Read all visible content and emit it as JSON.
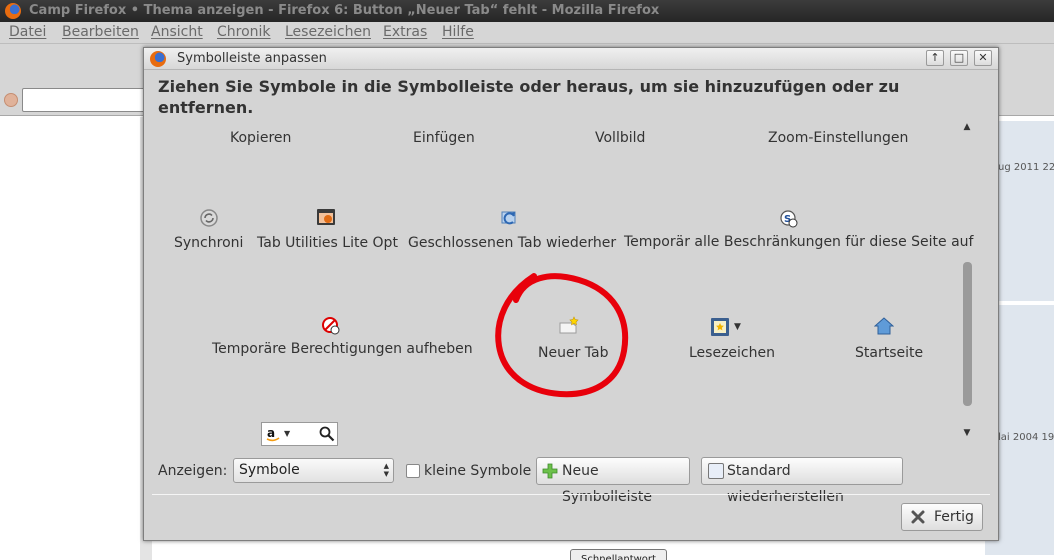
{
  "browser": {
    "window_title": "Camp Firefox • Thema anzeigen - Firefox 6: Button „Neuer Tab“ fehlt - Mozilla Firefox",
    "menu": [
      "Datei",
      "Bearbeiten",
      "Ansicht",
      "Chronik",
      "Lesezeichen",
      "Extras",
      "Hilfe"
    ],
    "background": {
      "date1": "ug 2011 22",
      "date2": "lai 2004 19",
      "button_label": "Schnellantwort"
    }
  },
  "dialog": {
    "title": "Symbolleiste anpassen",
    "instructions": "Ziehen Sie Symbole in die Symbolleiste oder heraus, um sie hinzuzufügen oder zu entfernen.",
    "palette": {
      "row1": [
        "Kopieren",
        "Einfügen",
        "Vollbild",
        "Zoom-Einstellungen"
      ],
      "row2": [
        "Synchroni",
        "Tab Utilities Lite Opt",
        "Geschlossenen Tab wiederher",
        "Temporär alle Beschränkungen für diese Seite auf"
      ],
      "row3": [
        "Temporäre Berechtigungen aufheben",
        "Neuer Tab",
        "Lesezeichen",
        "Startseite"
      ]
    },
    "highlight_color": "#e8000b",
    "show_label": "Anzeigen:",
    "show_value": "Symbole",
    "small_icons_label": "kleine Symbole",
    "small_icons_checked": false,
    "new_toolbar_label": "Neue Symbolleiste",
    "restore_label": "Standard wiederherstellen",
    "done_label": "Fertig"
  }
}
